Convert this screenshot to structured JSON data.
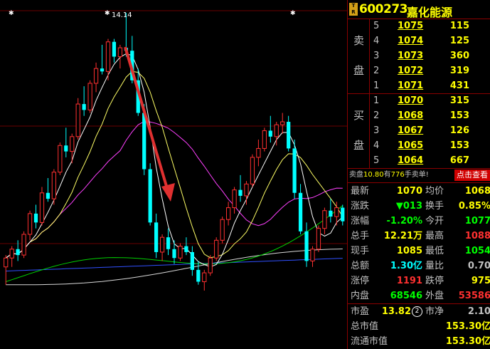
{
  "chart": {
    "price_label": "14.14",
    "marker_symbol": "✱",
    "trend_arrow_color": "#e03030",
    "candles": [
      [
        9.85,
        10.05,
        9.55,
        10.0
      ],
      [
        10.0,
        10.2,
        9.85,
        10.15
      ],
      [
        10.15,
        10.3,
        9.95,
        10.05
      ],
      [
        10.05,
        10.45,
        10.0,
        10.4
      ],
      [
        10.4,
        10.8,
        10.3,
        10.75
      ],
      [
        10.75,
        10.9,
        10.5,
        10.6
      ],
      [
        10.6,
        11.2,
        10.55,
        11.1
      ],
      [
        11.1,
        11.35,
        10.95,
        11.0
      ],
      [
        11.0,
        11.5,
        10.9,
        11.45
      ],
      [
        11.45,
        11.95,
        11.4,
        11.9
      ],
      [
        11.9,
        12.2,
        11.7,
        11.8
      ],
      [
        11.8,
        12.1,
        11.6,
        12.05
      ],
      [
        12.05,
        12.7,
        12.0,
        12.6
      ],
      [
        12.6,
        12.9,
        12.4,
        12.5
      ],
      [
        12.5,
        13.0,
        12.45,
        12.95
      ],
      [
        12.95,
        13.3,
        12.8,
        13.2
      ],
      [
        13.2,
        13.6,
        13.1,
        13.15
      ],
      [
        13.15,
        13.7,
        13.0,
        13.65
      ],
      [
        13.65,
        13.7,
        13.3,
        13.4
      ],
      [
        13.4,
        13.6,
        13.2,
        13.55
      ],
      [
        13.55,
        14.14,
        13.4,
        13.5
      ],
      [
        13.5,
        13.75,
        12.95,
        13.0
      ],
      [
        13.0,
        13.2,
        12.4,
        12.45
      ],
      [
        12.45,
        12.6,
        11.4,
        11.5
      ],
      [
        11.5,
        11.6,
        10.55,
        10.6
      ],
      [
        10.6,
        10.75,
        10.0,
        10.1
      ],
      [
        10.1,
        10.4,
        9.95,
        10.35
      ],
      [
        10.35,
        10.5,
        10.05,
        10.15
      ],
      [
        10.15,
        10.3,
        9.9,
        10.0
      ],
      [
        10.0,
        10.25,
        9.95,
        10.2
      ],
      [
        10.2,
        10.35,
        10.05,
        10.1
      ],
      [
        10.1,
        10.2,
        9.7,
        9.8
      ],
      [
        9.8,
        9.95,
        9.55,
        9.6
      ],
      [
        9.6,
        9.8,
        9.45,
        9.75
      ],
      [
        9.75,
        10.05,
        9.7,
        10.0
      ],
      [
        10.0,
        10.35,
        9.95,
        10.3
      ],
      [
        10.3,
        10.7,
        10.25,
        10.65
      ],
      [
        10.65,
        10.95,
        10.55,
        10.85
      ],
      [
        10.85,
        11.2,
        10.75,
        11.15
      ],
      [
        11.15,
        11.4,
        10.95,
        11.05
      ],
      [
        11.05,
        11.3,
        10.9,
        11.25
      ],
      [
        11.25,
        11.75,
        11.2,
        11.7
      ],
      [
        11.7,
        12.0,
        11.55,
        11.85
      ],
      [
        11.85,
        12.2,
        11.8,
        12.15
      ],
      [
        12.15,
        12.4,
        11.95,
        12.05
      ],
      [
        12.05,
        12.3,
        11.9,
        12.25
      ],
      [
        12.25,
        12.45,
        12.1,
        12.3
      ],
      [
        12.3,
        12.4,
        11.8,
        11.85
      ],
      [
        11.85,
        12.0,
        11.0,
        11.1
      ],
      [
        11.1,
        11.25,
        10.4,
        10.45
      ],
      [
        10.45,
        10.6,
        9.85,
        9.95
      ],
      [
        9.95,
        10.2,
        9.85,
        10.15
      ],
      [
        10.15,
        10.55,
        10.1,
        10.5
      ],
      [
        10.5,
        10.85,
        10.4,
        10.8
      ],
      [
        10.8,
        11.0,
        10.6,
        10.7
      ],
      [
        10.7,
        10.95,
        10.55,
        10.85
      ],
      [
        10.85,
        10.9,
        10.55,
        10.62
      ]
    ]
  },
  "header": {
    "badge_top": "T",
    "badge_bottom": "R",
    "code": "600273",
    "name": "嘉化能源"
  },
  "sell_book": {
    "label_a": "卖",
    "label_b": "盘",
    "rows": [
      {
        "level": "5",
        "price": "1075",
        "volume": "115"
      },
      {
        "level": "4",
        "price": "1074",
        "volume": "125"
      },
      {
        "level": "3",
        "price": "1073",
        "volume": "360"
      },
      {
        "level": "2",
        "price": "1072",
        "volume": "319"
      },
      {
        "level": "1",
        "price": "1071",
        "volume": "431"
      }
    ]
  },
  "buy_book": {
    "label_a": "买",
    "label_b": "盘",
    "rows": [
      {
        "level": "1",
        "price": "1070",
        "volume": "315"
      },
      {
        "level": "2",
        "price": "1068",
        "volume": "153"
      },
      {
        "level": "3",
        "price": "1067",
        "volume": "126"
      },
      {
        "level": "4",
        "price": "1065",
        "volume": "153"
      },
      {
        "level": "5",
        "price": "1064",
        "volume": "667"
      }
    ]
  },
  "order_msg": {
    "prefix": "卖盘",
    "price": "10.80",
    "mid": "有",
    "qty": "776",
    "suffix": "手卖单!",
    "button": "点击查看"
  },
  "quote": {
    "latest_label": "最新",
    "latest_value": "1070",
    "avg_label": "均价",
    "avg_value": "1068",
    "change_label": "涨跌",
    "change_value": "▼013",
    "turnover_label": "换手",
    "turnover_value": "0.85%",
    "pct_label": "涨幅",
    "pct_value": "-1.20%",
    "open_label": "今开",
    "open_value": "1077",
    "volume_label": "总手",
    "volume_value": "12.21万",
    "high_label": "最高",
    "high_value": "1088",
    "current_label": "现手",
    "current_value": "1085",
    "low_label": "最低",
    "low_value": "1054",
    "amount_label": "总额",
    "amount_value": "1.30亿",
    "ratio_label": "量比",
    "ratio_value": "0.70",
    "limitup_label": "涨停",
    "limitup_value": "1191",
    "limitdown_label": "跌停",
    "limitdown_value": "975",
    "inner_label": "内盘",
    "inner_value": "68546",
    "outer_label": "外盘",
    "outer_value": "53586",
    "pe_label": "市盈",
    "pe_value": "13.82",
    "pe_badge": "2",
    "pb_label": "市净",
    "pb_value": "2.10",
    "mktcap_label": "总市值",
    "mktcap_value": "153.30亿",
    "float_label": "流通市值",
    "float_value": "153.30亿"
  },
  "colors": {
    "up": "#ff3030",
    "down": "#00ffff",
    "ma5": "#ffffff",
    "ma10": "#ffff66",
    "ma20": "#ff40ff",
    "ma30": "#00d000",
    "ma60": "#3050ff",
    "ma120": "#d8d8d8"
  }
}
